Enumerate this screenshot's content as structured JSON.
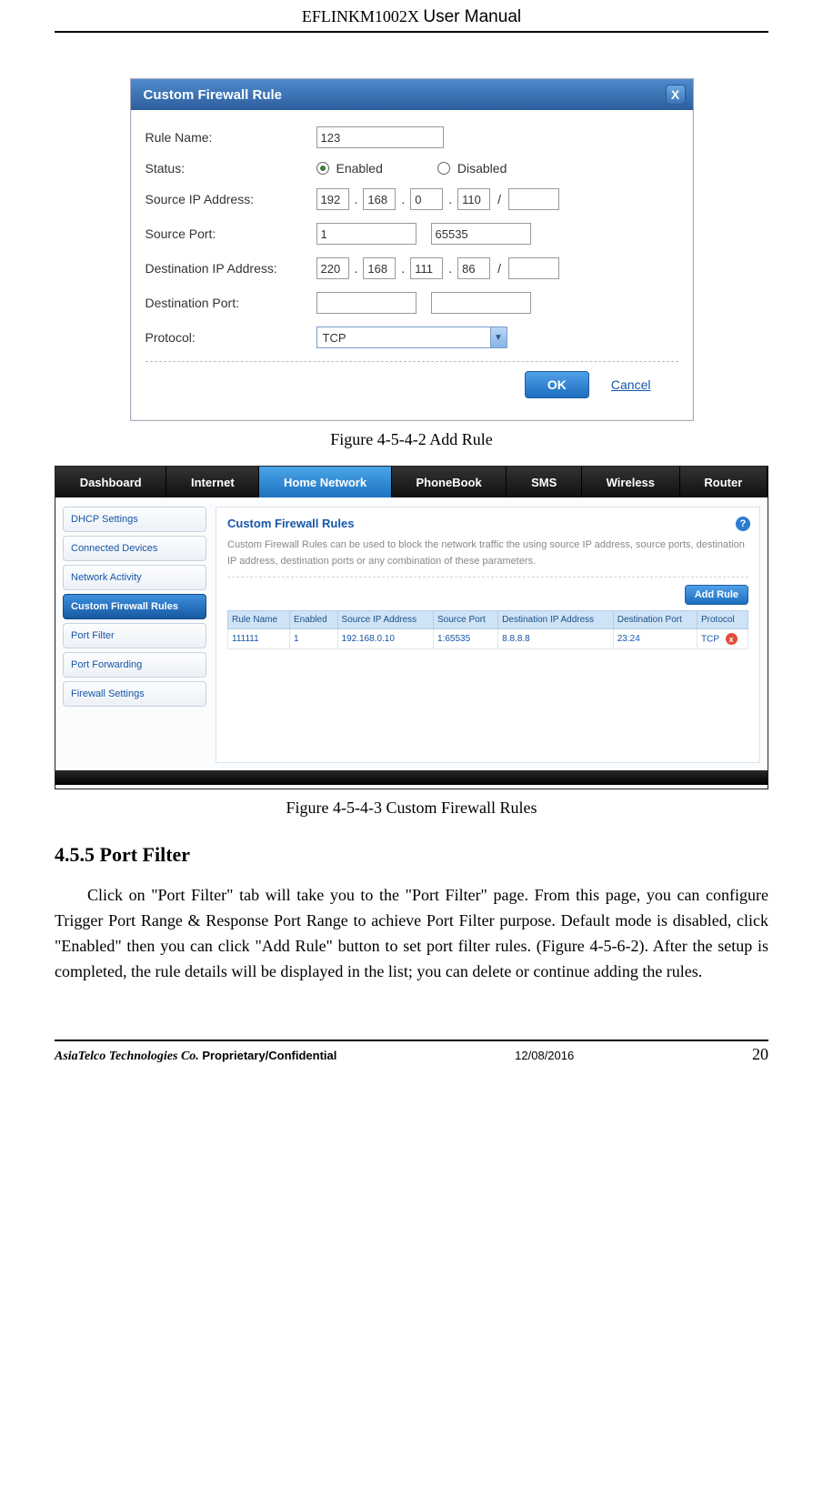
{
  "header": {
    "product": "EFLINKM1002X",
    "label": "User Manual"
  },
  "fig1": {
    "caption": "Figure 4-5-4-2 Add Rule",
    "dialog_title": "Custom Firewall Rule",
    "close_glyph": "X",
    "labels": {
      "rule_name": "Rule Name:",
      "status": "Status:",
      "src_ip": "Source IP Address:",
      "src_port": "Source Port:",
      "dst_ip": "Destination IP Address:",
      "dst_port": "Destination Port:",
      "protocol": "Protocol:"
    },
    "values": {
      "rule_name": "123",
      "status_enabled": "Enabled",
      "status_disabled": "Disabled",
      "status_selected": "enabled",
      "src_ip": [
        "192",
        "168",
        "0",
        "110"
      ],
      "src_mask": "",
      "src_port_from": "1",
      "src_port_to": "65535",
      "dst_ip": [
        "220",
        "168",
        "111",
        "86"
      ],
      "dst_mask": "",
      "dst_port_from": "",
      "dst_port_to": "",
      "protocol": "TCP"
    },
    "actions": {
      "ok": "OK",
      "cancel": "Cancel"
    }
  },
  "fig2": {
    "caption": "Figure 4-5-4-3 Custom Firewall Rules",
    "tabs": [
      "Dashboard",
      "Internet",
      "Home Network",
      "PhoneBook",
      "SMS",
      "Wireless",
      "Router"
    ],
    "active_tab": "Home Network",
    "side": [
      "DHCP Settings",
      "Connected Devices",
      "Network Activity",
      "Custom Firewall Rules",
      "Port Filter",
      "Port Forwarding",
      "Firewall Settings"
    ],
    "active_side": "Custom Firewall Rules",
    "panel": {
      "title": "Custom Firewall Rules",
      "help_glyph": "?",
      "desc": "Custom Firewall Rules can be used to block the network traffic the using source IP address, source ports, destination IP address, destination ports or any combination of these parameters.",
      "add_rule": "Add Rule",
      "columns": [
        "Rule Name",
        "Enabled",
        "Source IP Address",
        "Source Port",
        "Destination IP Address",
        "Destination Port",
        "Protocol"
      ],
      "rows": [
        {
          "name": "111111",
          "enabled": "1",
          "src_ip": "192.168.0.10",
          "src_port": "1:65535",
          "dst_ip": "8.8.8.8",
          "dst_port": "23:24",
          "protocol": "TCP"
        }
      ],
      "delete_glyph": "x"
    }
  },
  "section": {
    "title": "4.5.5 Port Filter",
    "body": "Click on \"Port Filter\" tab will take you to the \"Port Filter\" page. From this page, you can configure Trigger Port Range & Response Port Range to achieve Port Filter purpose. Default mode is disabled, click \"Enabled\" then you can click \"Add Rule\" button to set port filter rules. (Figure 4-5-6-2). After the setup is completed, the rule details will be displayed in the list; you can delete or continue adding the rules."
  },
  "footer": {
    "company": "AsiaTelco Technologies Co.",
    "pc": "Proprietary/Confidential",
    "date": "12/08/2016",
    "page": "20"
  }
}
